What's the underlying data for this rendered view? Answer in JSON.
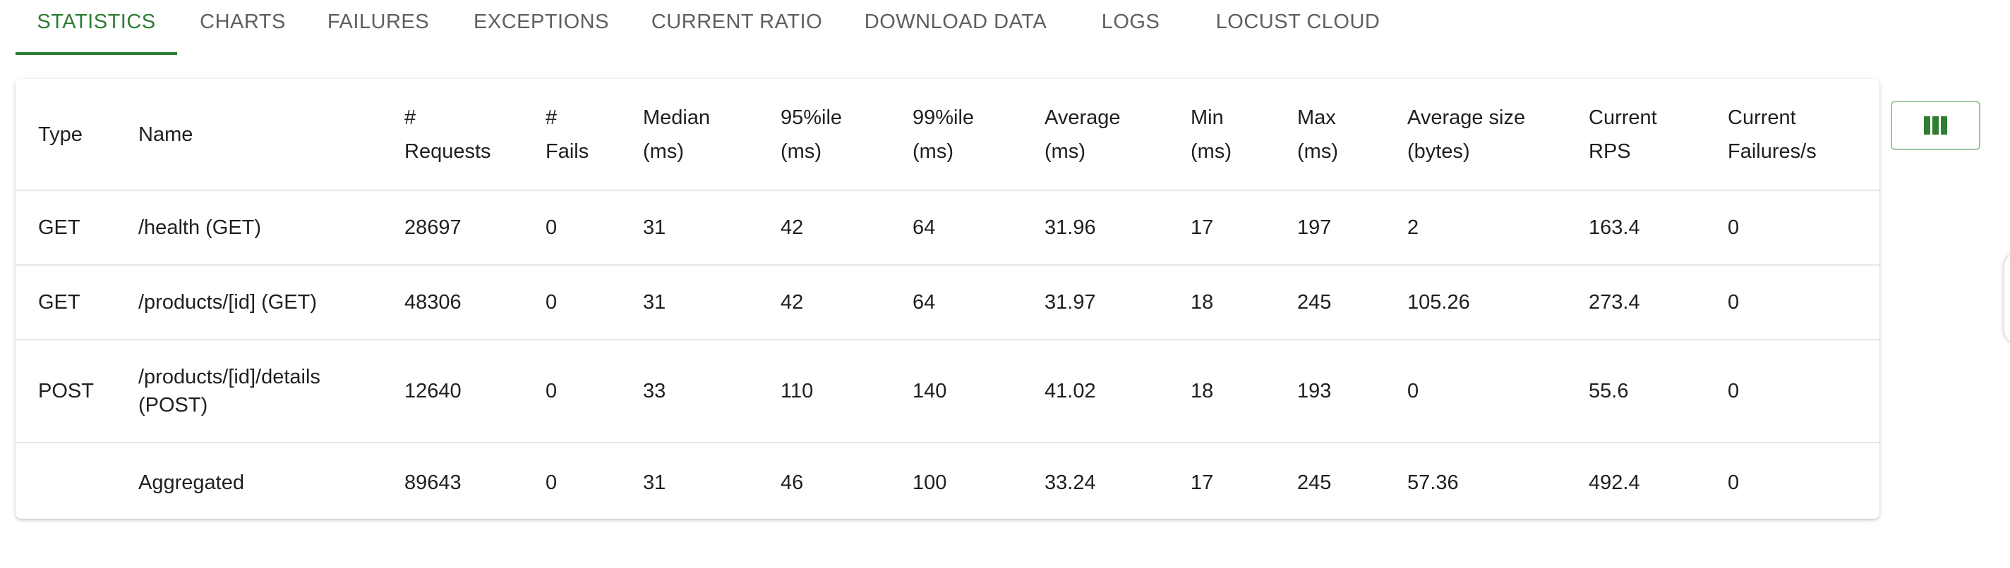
{
  "tabs": [
    {
      "label": "STATISTICS",
      "active": true
    },
    {
      "label": "CHARTS"
    },
    {
      "label": "FAILURES"
    },
    {
      "label": "EXCEPTIONS"
    },
    {
      "label": "CURRENT RATIO"
    },
    {
      "label": "DOWNLOAD DATA"
    },
    {
      "label": "LOGS"
    },
    {
      "label": "LOCUST CLOUD"
    }
  ],
  "table": {
    "headers": [
      [
        "Type"
      ],
      [
        "Name"
      ],
      [
        "#",
        "Requests"
      ],
      [
        "#",
        "Fails"
      ],
      [
        "Median",
        "(ms)"
      ],
      [
        "95%ile",
        "(ms)"
      ],
      [
        "99%ile",
        "(ms)"
      ],
      [
        "Average",
        "(ms)"
      ],
      [
        "Min",
        "(ms)"
      ],
      [
        "Max",
        "(ms)"
      ],
      [
        "Average size",
        "(bytes)"
      ],
      [
        "Current",
        "RPS"
      ],
      [
        "Current",
        "Failures/s"
      ]
    ],
    "rows": [
      [
        "GET",
        "/health (GET)",
        "28697",
        "0",
        "31",
        "42",
        "64",
        "31.96",
        "17",
        "197",
        "2",
        "163.4",
        "0"
      ],
      [
        "GET",
        "/products/[id] (GET)",
        "48306",
        "0",
        "31",
        "42",
        "64",
        "31.97",
        "18",
        "245",
        "105.26",
        "273.4",
        "0"
      ],
      [
        "POST",
        "/products/[id]/details (POST)",
        "12640",
        "0",
        "33",
        "110",
        "140",
        "41.02",
        "18",
        "193",
        "0",
        "55.6",
        "0"
      ],
      [
        "",
        "Aggregated",
        "89643",
        "0",
        "31",
        "46",
        "100",
        "33.24",
        "17",
        "245",
        "57.36",
        "492.4",
        "0"
      ]
    ]
  },
  "column_button": {
    "icon": "view-column-icon"
  },
  "colors": {
    "accent": "#2e7d32",
    "tab_text": "#5f5f5f",
    "text": "#1f1f1f"
  }
}
